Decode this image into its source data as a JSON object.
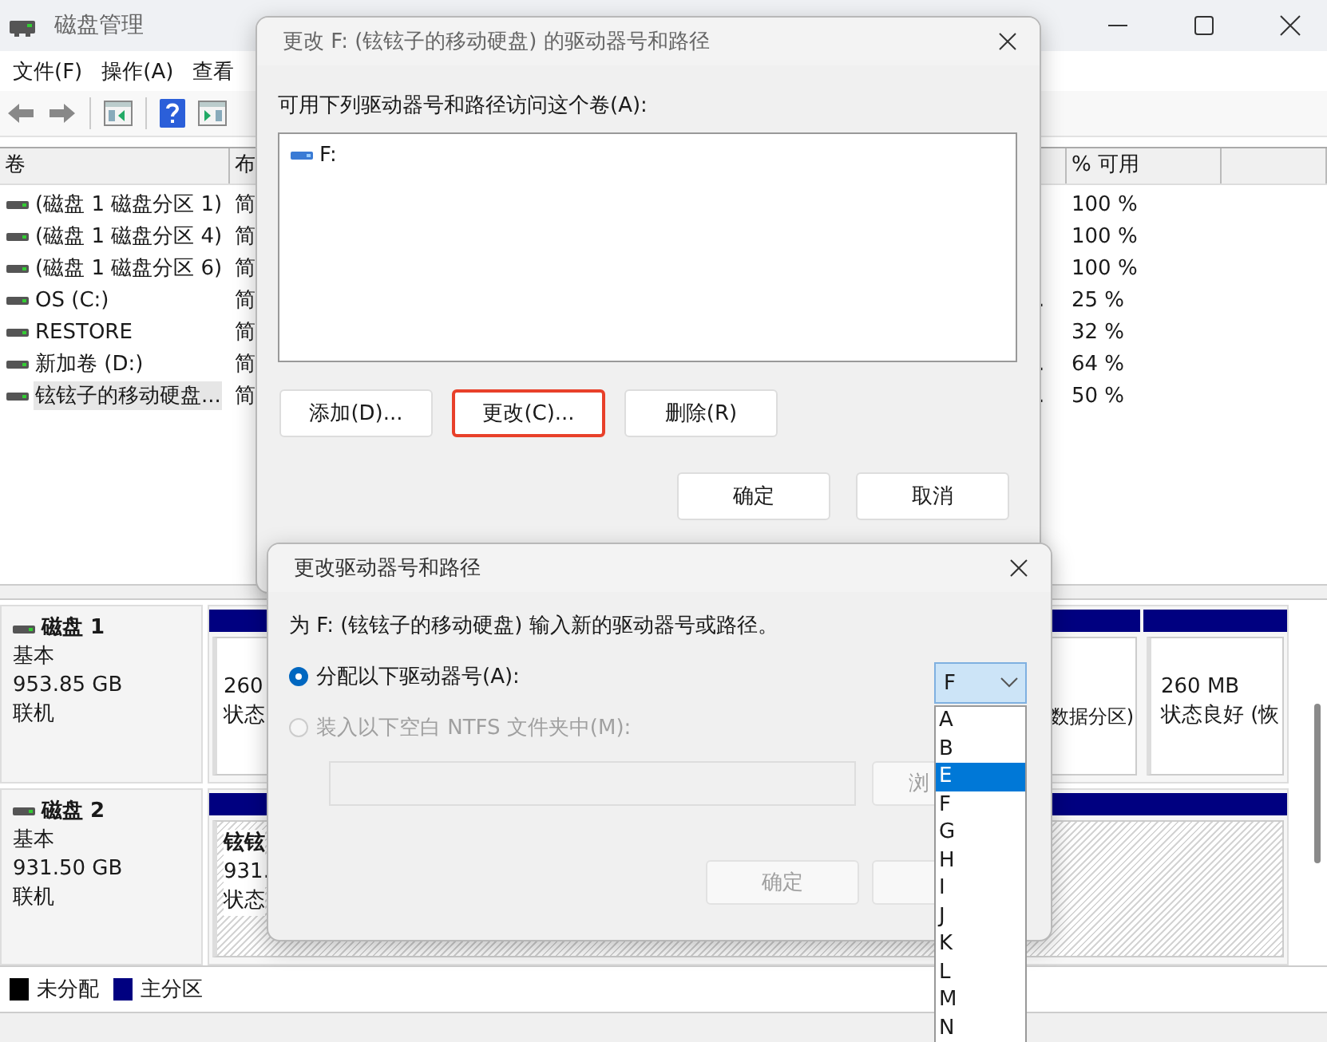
{
  "window": {
    "title": "磁盘管理"
  },
  "menu": [
    {
      "label": "文件(F)"
    },
    {
      "label": "操作(A)"
    },
    {
      "label": "查看"
    }
  ],
  "volume_table": {
    "columns": [
      "卷",
      "布",
      "% 可用"
    ],
    "rows": [
      {
        "name": "(磁盘 1 磁盘分区 1)",
        "layout": "简",
        "free": "100 %",
        "selected": false
      },
      {
        "name": "(磁盘 1 磁盘分区 4)",
        "layout": "简",
        "free": "100 %",
        "selected": false
      },
      {
        "name": "(磁盘 1 磁盘分区 6)",
        "layout": "简",
        "free": "100 %",
        "selected": false
      },
      {
        "name": "OS (C:)",
        "layout": "简",
        "tail": ".",
        "free": "25 %",
        "selected": false
      },
      {
        "name": "RESTORE",
        "layout": "简",
        "free": "32 %",
        "selected": false
      },
      {
        "name": "新加卷 (D:)",
        "layout": "简",
        "tail": ".",
        "free": "64 %",
        "selected": false
      },
      {
        "name": "铉铉子的移动硬盘...",
        "layout": "简",
        "tail": ".",
        "free": "50 %",
        "selected": true
      }
    ]
  },
  "disks": [
    {
      "name": "磁盘 1",
      "type": "基本",
      "size": "953.85 GB",
      "status": "联机",
      "partitions": [
        {
          "kind": "left",
          "selected": false,
          "lines": [
            "260",
            "状态"
          ]
        },
        {
          "kind": "clipped",
          "selected": false,
          "lines": [
            "数据分区)"
          ]
        },
        {
          "kind": "right",
          "selected": false,
          "lines": [
            "260 MB",
            "状态良好 (恢"
          ]
        }
      ]
    },
    {
      "name": "磁盘 2",
      "type": "基本",
      "size": "931.50 GB",
      "status": "联机",
      "partitions": [
        {
          "kind": "full",
          "selected": true,
          "lines": [
            "铉铉",
            "931.",
            "状态"
          ]
        }
      ]
    }
  ],
  "legend": [
    {
      "label": "未分配",
      "color": "#000000"
    },
    {
      "label": "主分区",
      "color": "#000080"
    }
  ],
  "paths_dialog": {
    "title": "更改 F: (铉铉子的移动硬盘) 的驱动器号和路径",
    "label": "可用下列驱动器号和路径访问这个卷(A):",
    "paths": [
      {
        "label": "F:"
      }
    ],
    "actions": [
      {
        "label": "添加(D)...",
        "highlighted": false
      },
      {
        "label": "更改(C)...",
        "highlighted": true
      },
      {
        "label": "删除(R)",
        "highlighted": false
      }
    ],
    "buttons": [
      "确定",
      "取消"
    ]
  },
  "change_dialog": {
    "title": "更改驱动器号和路径",
    "prompt": "为 F: (铉铉子的移动硬盘) 输入新的驱动器号或路径。",
    "options": [
      {
        "label": "分配以下驱动器号(A):",
        "selected": true,
        "disabled": false
      },
      {
        "label": "装入以下空白 NTFS 文件夹中(M):",
        "selected": false,
        "disabled": true
      }
    ],
    "drive_letter": {
      "value": "F",
      "expanded": true
    },
    "letters": [
      {
        "label": "A",
        "selected": false
      },
      {
        "label": "B",
        "selected": false
      },
      {
        "label": "E",
        "selected": true
      },
      {
        "label": "F",
        "selected": false
      },
      {
        "label": "G",
        "selected": false
      },
      {
        "label": "H",
        "selected": false
      },
      {
        "label": "I",
        "selected": false
      },
      {
        "label": "J",
        "selected": false
      },
      {
        "label": "K",
        "selected": false
      },
      {
        "label": "L",
        "selected": false
      },
      {
        "label": "M",
        "selected": false
      },
      {
        "label": "N",
        "selected": false
      }
    ],
    "browse": {
      "label": "浏",
      "disabled": true
    },
    "ok": {
      "label": "确定",
      "disabled": true
    }
  }
}
